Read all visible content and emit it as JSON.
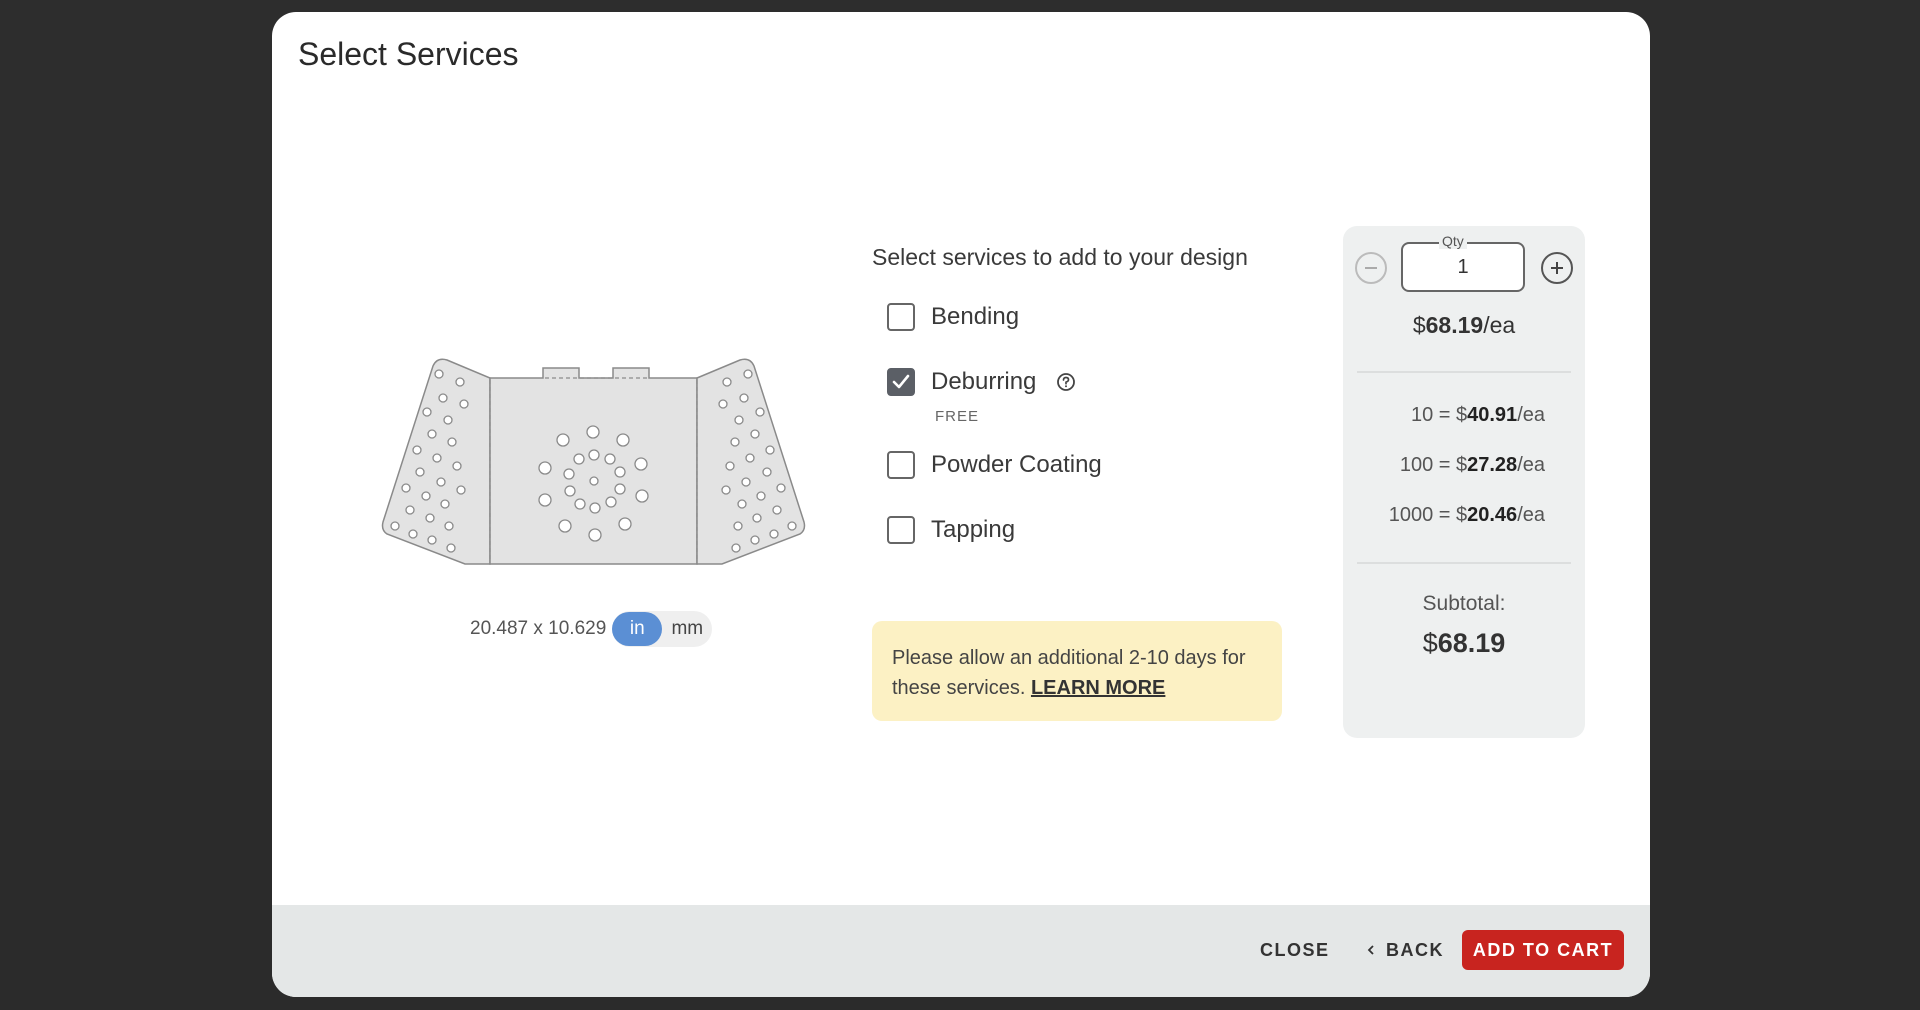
{
  "modal": {
    "title": "Select Services"
  },
  "preview": {
    "dimensions": "20.487 x 10.629",
    "units": [
      "in",
      "mm"
    ],
    "active_unit": "in"
  },
  "services": {
    "heading": "Select services to add to your design",
    "items": [
      {
        "label": "Bending",
        "checked": false
      },
      {
        "label": "Deburring",
        "checked": true,
        "sublabel": "FREE",
        "help_icon": "question-circle-icon"
      },
      {
        "label": "Powder Coating",
        "checked": false
      },
      {
        "label": "Tapping",
        "checked": false
      }
    ]
  },
  "notice": {
    "text": "Please allow an additional 2-10 days for these services.",
    "link": "LEARN MORE"
  },
  "pricing": {
    "qty_label": "Qty",
    "qty_value": "1",
    "unit_price_symbol": "$",
    "unit_price": "68.19",
    "unit_suffix": "/ea",
    "tiers": [
      {
        "qty": "10 = $",
        "price": "40.91",
        "suffix": "/ea"
      },
      {
        "qty": "100 = $",
        "price": "27.28",
        "suffix": "/ea"
      },
      {
        "qty": "1000 = $",
        "price": "20.46",
        "suffix": "/ea"
      }
    ],
    "subtotal_label": "Subtotal:",
    "subtotal_symbol": "$",
    "subtotal_value": "68.19"
  },
  "footer": {
    "close_label": "CLOSE",
    "back_label": "BACK",
    "add_to_cart_label": "ADD TO CART"
  },
  "colors": {
    "accent_blue": "#5b8fd4",
    "cart_red": "#c8241f",
    "notice_bg": "#fcf1c4"
  }
}
